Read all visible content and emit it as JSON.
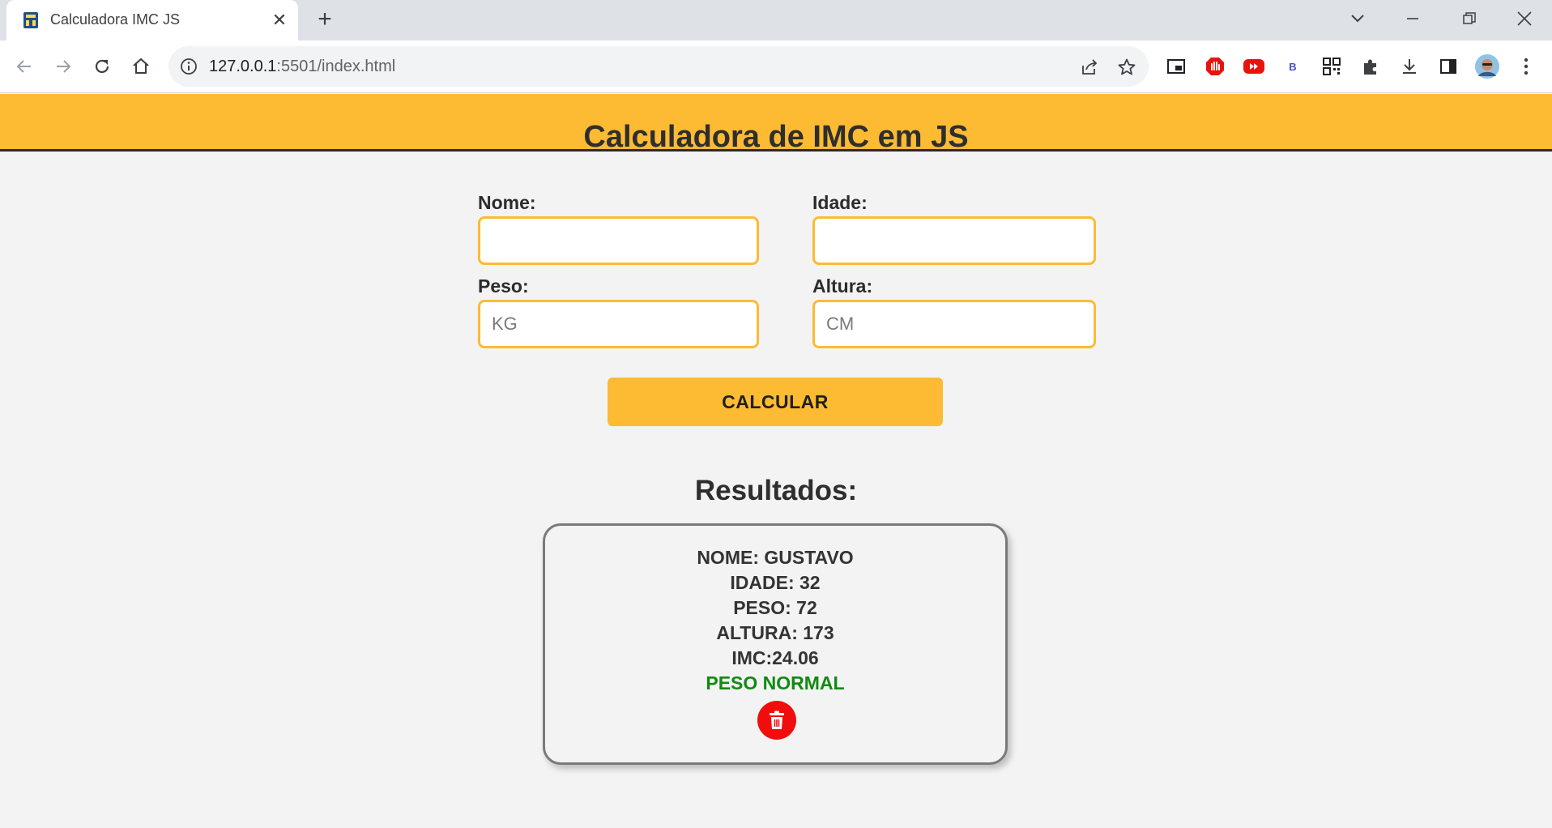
{
  "browser": {
    "tab_title": "Calculadora IMC JS",
    "tab_close": "✕",
    "new_tab": "+",
    "url_host": "127.0.0.1",
    "url_rest": ":5501/index.html",
    "extension_b_label": "B"
  },
  "page": {
    "title": "Calculadora de IMC em JS",
    "form": {
      "nome_label": "Nome:",
      "idade_label": "Idade:",
      "peso_label": "Peso:",
      "peso_placeholder": "KG",
      "altura_label": "Altura:",
      "altura_placeholder": "CM",
      "nome_value": "",
      "idade_value": "",
      "peso_value": "",
      "altura_value": ""
    },
    "calculate_label": "CALCULAR",
    "results": {
      "heading": "Resultados:",
      "nome": "NOME: GUSTAVO",
      "idade": "IDADE: 32",
      "peso": "PESO: 72",
      "altura": "ALTURA: 173",
      "imc": "IMC:24.06",
      "status": "PESO NORMAL",
      "status_color": "#128a12"
    }
  },
  "colors": {
    "accent": "#fdbb34",
    "delete": "#f20d0d"
  }
}
